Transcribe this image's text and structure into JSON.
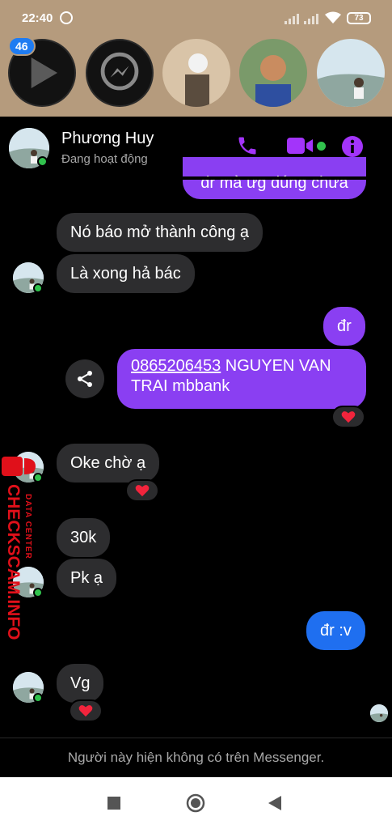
{
  "status_bar": {
    "time": "22:40",
    "battery": "73"
  },
  "chat_heads": {
    "badge": "46"
  },
  "contact": {
    "name": "Phương Huy",
    "status": "Đang hoạt động"
  },
  "messages": {
    "m0": "đr mà ưg dúng chưa",
    "m1": "Nó báo mở thành công ạ",
    "m2": "Là xong hả bác",
    "m3": "đr",
    "m4_phone": "0865206453",
    "m4_line1_rest": " NGUYEN VAN",
    "m4_line2": "TRAI mbbank",
    "m5": "Oke chờ ạ",
    "m6": "30k",
    "m7": "Pk ạ",
    "m8": "đr :v",
    "m9": "Vg"
  },
  "footer": {
    "note": "Người này hiện không có trên Messenger."
  },
  "watermark": {
    "brand": "CHECKSCAM.INFO",
    "tag": "DATA CENTER"
  },
  "colors": {
    "accent_purple": "#8a3ff2",
    "accent_blue": "#1f6ff0",
    "incoming_bubble": "#2d2d2f",
    "online_green": "#31c24d",
    "heart_red": "#f2243c",
    "watermark_red": "#e0101a"
  },
  "icons": [
    "play-icon",
    "messenger-icon",
    "phone-icon",
    "video-icon",
    "info-icon",
    "share-icon",
    "heart-icon",
    "stop-icon",
    "home-icon",
    "back-icon"
  ]
}
